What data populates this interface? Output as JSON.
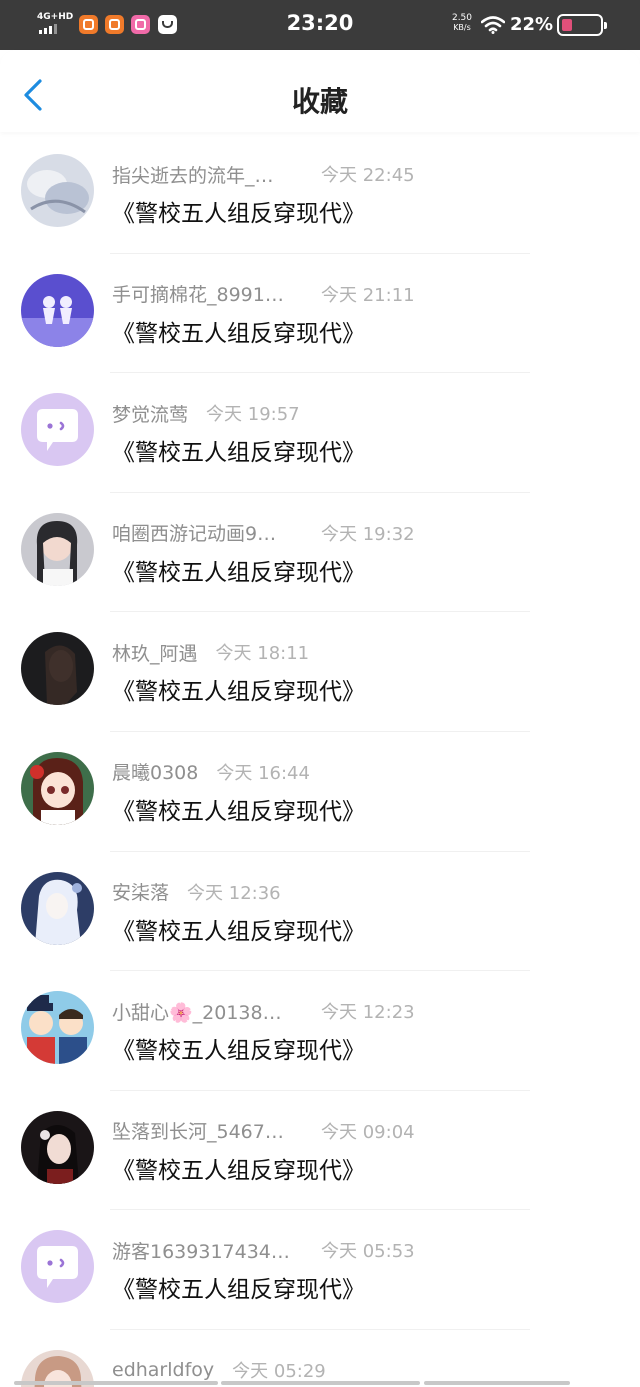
{
  "status_bar": {
    "network": "4G+HD",
    "time": "23:20",
    "speed_value": "2.50",
    "speed_unit": "KB/s",
    "battery": "22%",
    "app_icons": [
      "app-icon-orange",
      "app-icon-orange",
      "app-icon-pink",
      "app-icon-white"
    ]
  },
  "nav": {
    "title": "收藏",
    "back_icon": "chevron-left-icon"
  },
  "colors": {
    "accent": "#1d8ce0",
    "placeholder_avatar_bg": "#d9c7f2",
    "placeholder_avatar_fg": "#9b74d6"
  },
  "items": [
    {
      "user": "指尖逝去的流年_…",
      "time": "今天 22:45",
      "title": "《警校五人组反穿现代》",
      "avatar": "photo-avatar"
    },
    {
      "user": "手可摘棉花_8991…",
      "time": "今天 21:11",
      "title": "《警校五人组反穿现代》",
      "avatar": "photo-avatar"
    },
    {
      "user": "梦觉流莺",
      "time": "今天 19:57",
      "title": "《警校五人组反穿现代》",
      "avatar": "default-chat-avatar"
    },
    {
      "user": "咱圈西游记动画9…",
      "time": "今天 19:32",
      "title": "《警校五人组反穿现代》",
      "avatar": "photo-avatar"
    },
    {
      "user": "林玖_阿遇",
      "time": "今天 18:11",
      "title": "《警校五人组反穿现代》",
      "avatar": "photo-avatar"
    },
    {
      "user": "晨曦0308",
      "time": "今天 16:44",
      "title": "《警校五人组反穿现代》",
      "avatar": "photo-avatar"
    },
    {
      "user": "安柒落",
      "time": "今天 12:36",
      "title": "《警校五人组反穿现代》",
      "avatar": "photo-avatar"
    },
    {
      "user": "小甜心🌸_20138…",
      "time": "今天 12:23",
      "title": "《警校五人组反穿现代》",
      "avatar": "photo-avatar"
    },
    {
      "user": "坠落到长河_5467…",
      "time": "今天 09:04",
      "title": "《警校五人组反穿现代》",
      "avatar": "photo-avatar"
    },
    {
      "user": "游客1639317434…",
      "time": "今天 05:53",
      "title": "《警校五人组反穿现代》",
      "avatar": "default-chat-avatar"
    },
    {
      "user": "edharldfoy",
      "time": "今天 05:29",
      "title": "",
      "avatar": "photo-avatar"
    }
  ]
}
